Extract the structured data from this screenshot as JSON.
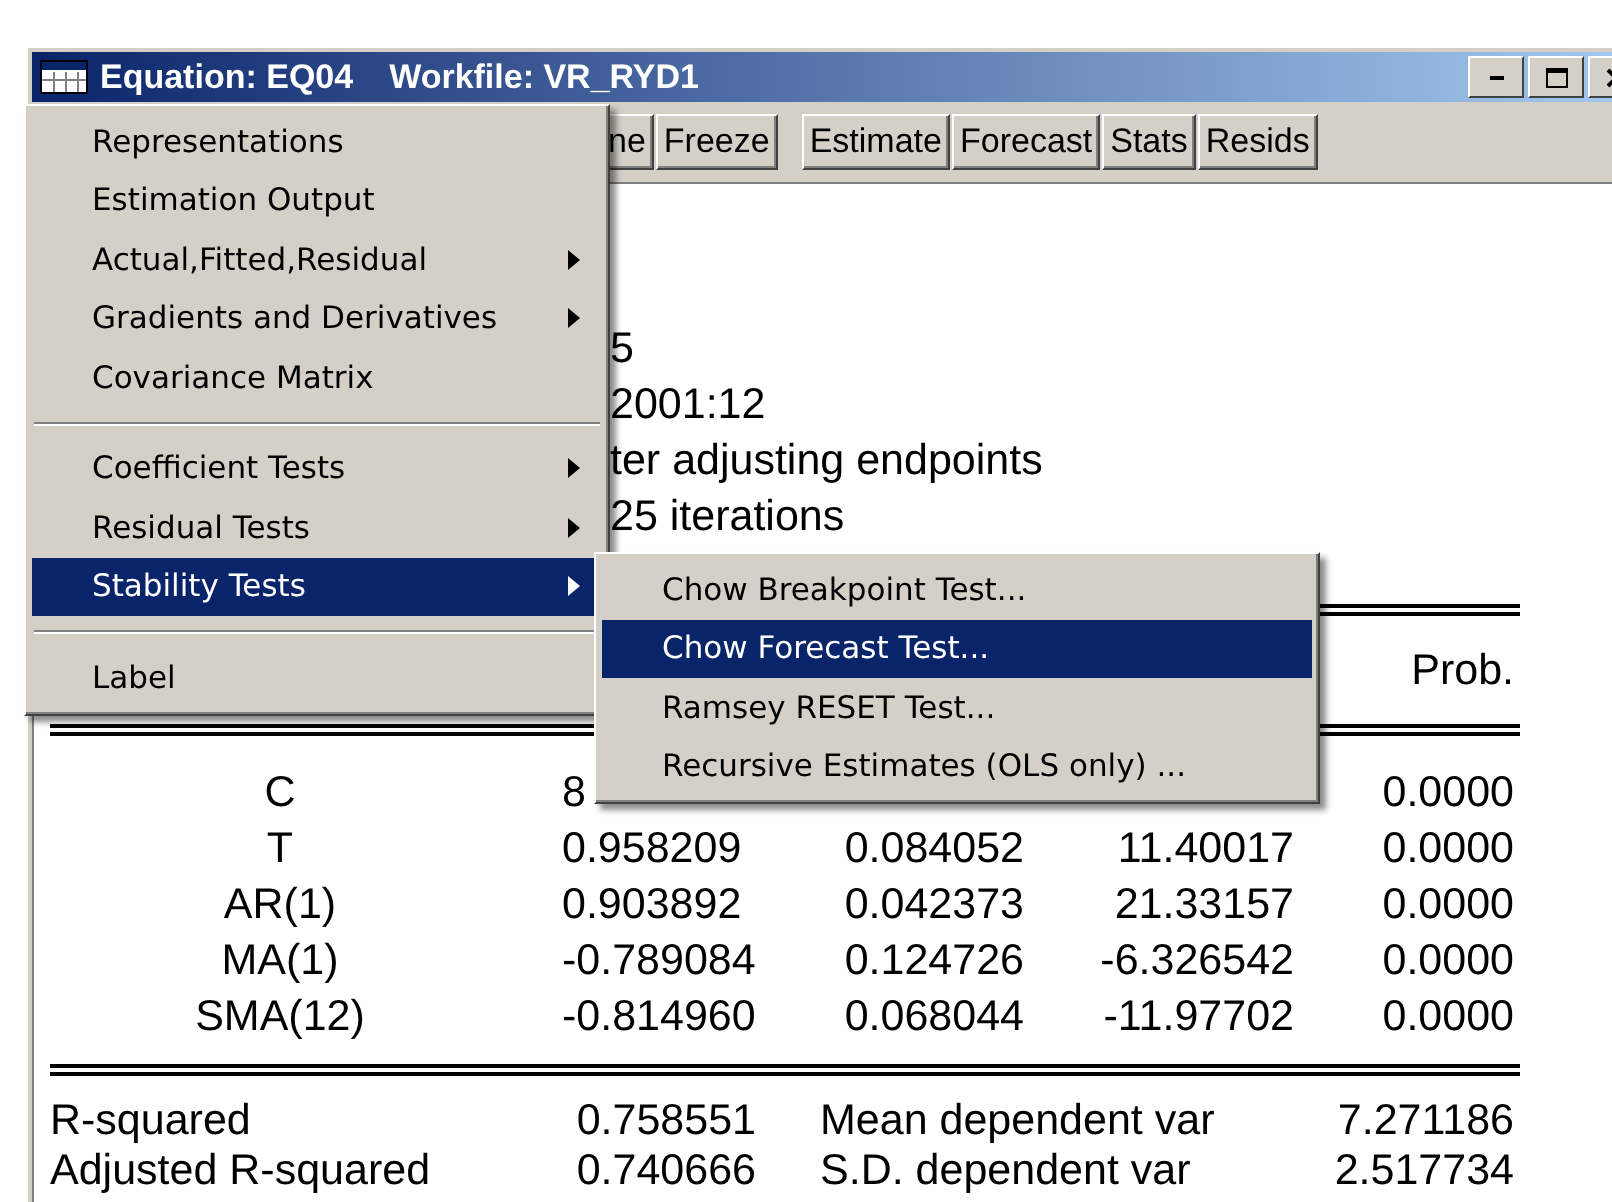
{
  "window": {
    "title": "Equation: EQ04",
    "workfile": "Workfile: VR_RYD1"
  },
  "toolbar_groups": [
    {
      "buttons": [
        "ne",
        "Freeze"
      ]
    },
    {
      "buttons": [
        "Estimate",
        "Forecast",
        "Stats",
        "Resids"
      ]
    }
  ],
  "header_lines": [
    "5",
    "2001:12",
    "ter adjusting endpoints",
    "25 iterations"
  ],
  "table": {
    "header": {
      "column_5": "Prob."
    },
    "rows": [
      {
        "column_1": "C",
        "column_2": "8",
        "column_5": "0.0000"
      },
      {
        "column_1": "T",
        "column_2": "0.958209",
        "column_3": "0.084052",
        "column_4": "11.40017",
        "column_5": "0.0000"
      },
      {
        "column_1": "AR(1)",
        "column_2": "0.903892",
        "column_3": "0.042373",
        "column_4": "21.33157",
        "column_5": "0.0000"
      },
      {
        "column_1": "MA(1)",
        "column_2": "-0.789084",
        "column_3": "0.124726",
        "column_4": "-6.326542",
        "column_5": "0.0000"
      },
      {
        "column_1": "SMA(12)",
        "column_2": "-0.814960",
        "column_3": "0.068044",
        "column_4": "-11.97702",
        "column_5": "0.0000"
      }
    ]
  },
  "stats": [
    {
      "label": "R-squared",
      "value": "0.758551",
      "label_2": "Mean dependent var",
      "value_2": "7.271186"
    },
    {
      "label": "Adjusted R-squared",
      "value": "0.740666",
      "label_2": "S.D. dependent var",
      "value_2": "2.517734"
    }
  ],
  "menu": {
    "items": [
      {
        "kind": "item",
        "label": "Representations",
        "submenu": false,
        "selected": false
      },
      {
        "kind": "item",
        "label": "Estimation Output",
        "submenu": false,
        "selected": false
      },
      {
        "kind": "item",
        "label": "Actual,Fitted,Residual",
        "submenu": true,
        "selected": false
      },
      {
        "kind": "item",
        "label": "Gradients and Derivatives",
        "submenu": true,
        "selected": false
      },
      {
        "kind": "item",
        "label": "Covariance Matrix",
        "submenu": false,
        "selected": false
      },
      {
        "kind": "separator"
      },
      {
        "kind": "item",
        "label": "Coefficient Tests",
        "submenu": true,
        "selected": false
      },
      {
        "kind": "item",
        "label": "Residual Tests",
        "submenu": true,
        "selected": false
      },
      {
        "kind": "item",
        "label": "Stability Tests",
        "submenu": true,
        "selected": true
      },
      {
        "kind": "separator"
      },
      {
        "kind": "item",
        "label": "Label",
        "submenu": false,
        "selected": false
      }
    ]
  },
  "submenu": {
    "items": [
      {
        "kind": "item",
        "label": "Chow Breakpoint Test...",
        "submenu": false,
        "selected": false
      },
      {
        "kind": "item",
        "label": "Chow Forecast Test...",
        "submenu": false,
        "selected": true
      },
      {
        "kind": "item",
        "label": "Ramsey RESET Test...",
        "submenu": false,
        "selected": false
      },
      {
        "kind": "item",
        "label": "Recursive Estimates (OLS only) ...",
        "submenu": false,
        "selected": false
      }
    ]
  }
}
